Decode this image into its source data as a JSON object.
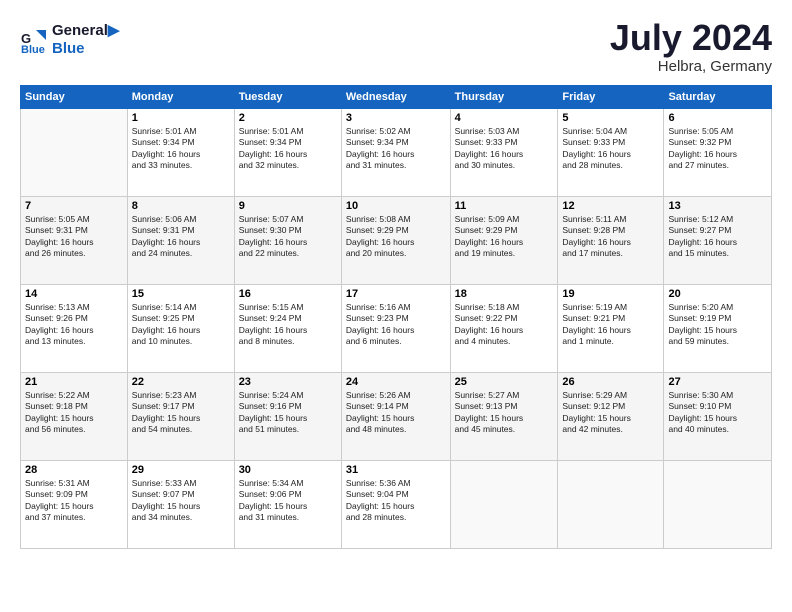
{
  "header": {
    "logo_line1": "General",
    "logo_line2": "Blue",
    "month": "July 2024",
    "location": "Helbra, Germany"
  },
  "weekdays": [
    "Sunday",
    "Monday",
    "Tuesday",
    "Wednesday",
    "Thursday",
    "Friday",
    "Saturday"
  ],
  "weeks": [
    [
      {
        "day": "",
        "info": ""
      },
      {
        "day": "1",
        "info": "Sunrise: 5:01 AM\nSunset: 9:34 PM\nDaylight: 16 hours\nand 33 minutes."
      },
      {
        "day": "2",
        "info": "Sunrise: 5:01 AM\nSunset: 9:34 PM\nDaylight: 16 hours\nand 32 minutes."
      },
      {
        "day": "3",
        "info": "Sunrise: 5:02 AM\nSunset: 9:34 PM\nDaylight: 16 hours\nand 31 minutes."
      },
      {
        "day": "4",
        "info": "Sunrise: 5:03 AM\nSunset: 9:33 PM\nDaylight: 16 hours\nand 30 minutes."
      },
      {
        "day": "5",
        "info": "Sunrise: 5:04 AM\nSunset: 9:33 PM\nDaylight: 16 hours\nand 28 minutes."
      },
      {
        "day": "6",
        "info": "Sunrise: 5:05 AM\nSunset: 9:32 PM\nDaylight: 16 hours\nand 27 minutes."
      }
    ],
    [
      {
        "day": "7",
        "info": "Sunrise: 5:05 AM\nSunset: 9:31 PM\nDaylight: 16 hours\nand 26 minutes."
      },
      {
        "day": "8",
        "info": "Sunrise: 5:06 AM\nSunset: 9:31 PM\nDaylight: 16 hours\nand 24 minutes."
      },
      {
        "day": "9",
        "info": "Sunrise: 5:07 AM\nSunset: 9:30 PM\nDaylight: 16 hours\nand 22 minutes."
      },
      {
        "day": "10",
        "info": "Sunrise: 5:08 AM\nSunset: 9:29 PM\nDaylight: 16 hours\nand 20 minutes."
      },
      {
        "day": "11",
        "info": "Sunrise: 5:09 AM\nSunset: 9:29 PM\nDaylight: 16 hours\nand 19 minutes."
      },
      {
        "day": "12",
        "info": "Sunrise: 5:11 AM\nSunset: 9:28 PM\nDaylight: 16 hours\nand 17 minutes."
      },
      {
        "day": "13",
        "info": "Sunrise: 5:12 AM\nSunset: 9:27 PM\nDaylight: 16 hours\nand 15 minutes."
      }
    ],
    [
      {
        "day": "14",
        "info": "Sunrise: 5:13 AM\nSunset: 9:26 PM\nDaylight: 16 hours\nand 13 minutes."
      },
      {
        "day": "15",
        "info": "Sunrise: 5:14 AM\nSunset: 9:25 PM\nDaylight: 16 hours\nand 10 minutes."
      },
      {
        "day": "16",
        "info": "Sunrise: 5:15 AM\nSunset: 9:24 PM\nDaylight: 16 hours\nand 8 minutes."
      },
      {
        "day": "17",
        "info": "Sunrise: 5:16 AM\nSunset: 9:23 PM\nDaylight: 16 hours\nand 6 minutes."
      },
      {
        "day": "18",
        "info": "Sunrise: 5:18 AM\nSunset: 9:22 PM\nDaylight: 16 hours\nand 4 minutes."
      },
      {
        "day": "19",
        "info": "Sunrise: 5:19 AM\nSunset: 9:21 PM\nDaylight: 16 hours\nand 1 minute."
      },
      {
        "day": "20",
        "info": "Sunrise: 5:20 AM\nSunset: 9:19 PM\nDaylight: 15 hours\nand 59 minutes."
      }
    ],
    [
      {
        "day": "21",
        "info": "Sunrise: 5:22 AM\nSunset: 9:18 PM\nDaylight: 15 hours\nand 56 minutes."
      },
      {
        "day": "22",
        "info": "Sunrise: 5:23 AM\nSunset: 9:17 PM\nDaylight: 15 hours\nand 54 minutes."
      },
      {
        "day": "23",
        "info": "Sunrise: 5:24 AM\nSunset: 9:16 PM\nDaylight: 15 hours\nand 51 minutes."
      },
      {
        "day": "24",
        "info": "Sunrise: 5:26 AM\nSunset: 9:14 PM\nDaylight: 15 hours\nand 48 minutes."
      },
      {
        "day": "25",
        "info": "Sunrise: 5:27 AM\nSunset: 9:13 PM\nDaylight: 15 hours\nand 45 minutes."
      },
      {
        "day": "26",
        "info": "Sunrise: 5:29 AM\nSunset: 9:12 PM\nDaylight: 15 hours\nand 42 minutes."
      },
      {
        "day": "27",
        "info": "Sunrise: 5:30 AM\nSunset: 9:10 PM\nDaylight: 15 hours\nand 40 minutes."
      }
    ],
    [
      {
        "day": "28",
        "info": "Sunrise: 5:31 AM\nSunset: 9:09 PM\nDaylight: 15 hours\nand 37 minutes."
      },
      {
        "day": "29",
        "info": "Sunrise: 5:33 AM\nSunset: 9:07 PM\nDaylight: 15 hours\nand 34 minutes."
      },
      {
        "day": "30",
        "info": "Sunrise: 5:34 AM\nSunset: 9:06 PM\nDaylight: 15 hours\nand 31 minutes."
      },
      {
        "day": "31",
        "info": "Sunrise: 5:36 AM\nSunset: 9:04 PM\nDaylight: 15 hours\nand 28 minutes."
      },
      {
        "day": "",
        "info": ""
      },
      {
        "day": "",
        "info": ""
      },
      {
        "day": "",
        "info": ""
      }
    ]
  ]
}
